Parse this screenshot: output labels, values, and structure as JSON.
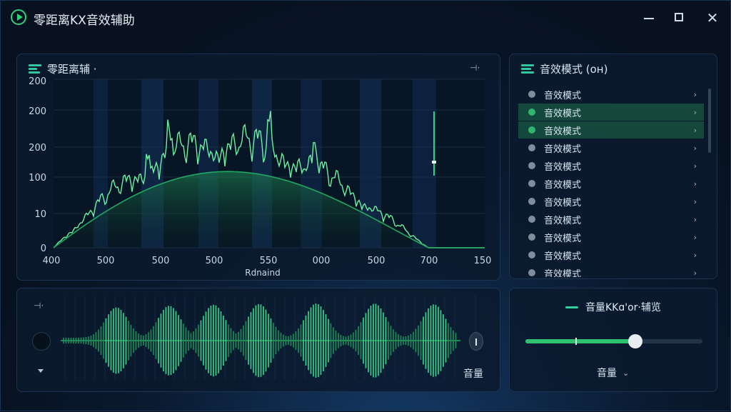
{
  "window": {
    "title": "零距离KX音效辅助",
    "minimize_label": "",
    "maximize_label": "",
    "close_label": "✕"
  },
  "spectrum": {
    "title": "零距离辅 ·",
    "pin_label": "⊣·",
    "y_ticks": [
      "200",
      "200",
      "200",
      "100",
      "10",
      "0"
    ],
    "x_ticks": [
      "400",
      "500",
      "500",
      "500",
      "550",
      "000",
      "500",
      "700",
      "150"
    ],
    "x_label": "Rdnaind"
  },
  "wave": {
    "tick_label": "⊣·",
    "volume_label": "音量"
  },
  "mode_panel": {
    "title": "音效模式 (ᴏʜ)",
    "items": [
      {
        "label": "音效模式",
        "active": false
      },
      {
        "label": "音效模式",
        "active": true
      },
      {
        "label": "音效模式",
        "active": true
      },
      {
        "label": "音效模式",
        "active": false
      },
      {
        "label": "音效模式",
        "active": false
      },
      {
        "label": "音效模式",
        "active": false
      },
      {
        "label": "音效模式",
        "active": false
      },
      {
        "label": "音效模式",
        "active": false
      },
      {
        "label": "音效模式",
        "active": false
      },
      {
        "label": "音效模式",
        "active": false
      },
      {
        "label": "音效模式",
        "active": false
      }
    ],
    "arrow": "›"
  },
  "volume_panel": {
    "title": "音量KKɑ'or·辅览",
    "slider_level": 0.62,
    "select_label": "音量",
    "chevron": "⌄"
  },
  "colors": {
    "accent": "#2fd27a",
    "line_light": "#6ff0a0",
    "line_dark": "#22a862",
    "panel_bg": "#0a1a2e"
  }
}
